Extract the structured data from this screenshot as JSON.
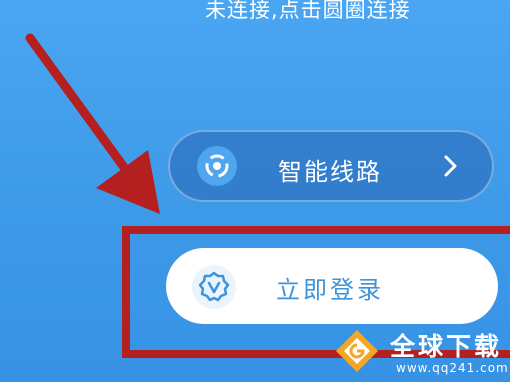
{
  "status": {
    "text": "未连接,点击圆圈连接"
  },
  "route": {
    "label": "智能线路",
    "icon": "swirl-route-icon"
  },
  "login": {
    "label": "立即登录",
    "icon": "v-badge-icon"
  },
  "watermark": {
    "title": "全球下载",
    "url": "www.qq241.com"
  },
  "colors": {
    "background": "#3d9ae8",
    "accent_red": "#b3201f",
    "login_text": "#3f93d8",
    "route_pill": "#2864b4"
  }
}
